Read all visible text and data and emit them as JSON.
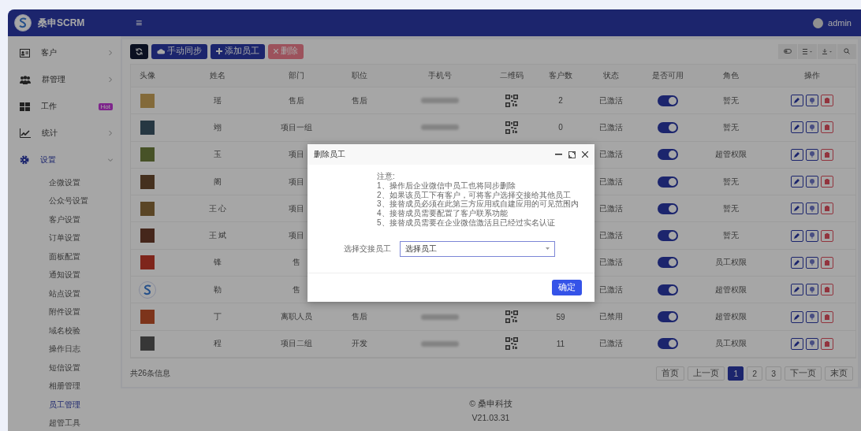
{
  "header": {
    "brand": "桑申SCRM",
    "menu_glyph": "≡",
    "user": "admin"
  },
  "sidebar": {
    "items": [
      {
        "label": "客户",
        "kind": "card",
        "expanded": false,
        "has_children": true
      },
      {
        "label": "群管理",
        "kind": "people",
        "expanded": false,
        "has_children": true
      },
      {
        "label": "工作",
        "kind": "grid",
        "expanded": false,
        "has_children": false,
        "badge": "Hot"
      },
      {
        "label": "统计",
        "kind": "chart",
        "expanded": false,
        "has_children": true
      },
      {
        "label": "设置",
        "kind": "gear",
        "expanded": true,
        "has_children": true,
        "children": [
          {
            "label": "企微设置",
            "selected": false
          },
          {
            "label": "公众号设置",
            "selected": false
          },
          {
            "label": "客户设置",
            "selected": false
          },
          {
            "label": "订单设置",
            "selected": false
          },
          {
            "label": "面板配置",
            "selected": false
          },
          {
            "label": "通知设置",
            "selected": false
          },
          {
            "label": "站点设置",
            "selected": false
          },
          {
            "label": "附件设置",
            "selected": false
          },
          {
            "label": "域名校验",
            "selected": false
          },
          {
            "label": "操作日志",
            "selected": false
          },
          {
            "label": "短信设置",
            "selected": false
          },
          {
            "label": "相册管理",
            "selected": false
          },
          {
            "label": "员工管理",
            "selected": true
          },
          {
            "label": "超管工具",
            "selected": false
          }
        ]
      }
    ]
  },
  "toolbar": {
    "buttons": [
      {
        "kind": "refresh",
        "disabled": false
      },
      {
        "kind": "sync",
        "label": "手动同步",
        "disabled": false
      },
      {
        "kind": "add",
        "label": "添加员工",
        "disabled": false
      },
      {
        "kind": "delete",
        "label": "删除",
        "disabled": true
      }
    ]
  },
  "table": {
    "columns": [
      "头像",
      "姓名",
      "部门",
      "职位",
      "手机号",
      "二维码",
      "客户数",
      "状态",
      "是否可用",
      "角色",
      "操作"
    ],
    "rows": [
      {
        "avatar": {
          "kind": "photo"
        },
        "name": "瑶",
        "department": "售后",
        "position": "售后",
        "phone_redacted": true,
        "qr": true,
        "customers": "2",
        "status": "已激活",
        "enabled": true,
        "role": "暂无"
      },
      {
        "avatar": {
          "kind": "photo"
        },
        "name": "翊",
        "department": "项目一组",
        "phone_redacted": true,
        "qr": true,
        "customers": "0",
        "status": "已激活",
        "enabled": true,
        "role": "暂无"
      },
      {
        "avatar": {
          "kind": "photo"
        },
        "name": "玉",
        "department": "项目",
        "status": "已激活",
        "enabled": true,
        "role": "超管权限"
      },
      {
        "avatar": {
          "kind": "photo"
        },
        "name": "阁",
        "department": "项目",
        "status": "已激活",
        "enabled": true,
        "role": "暂无"
      },
      {
        "avatar": {
          "kind": "photo"
        },
        "name": "王 心",
        "department": "项目",
        "status": "已激活",
        "enabled": true,
        "role": "暂无"
      },
      {
        "avatar": {
          "kind": "photo"
        },
        "name": "王 斌",
        "department": "项目",
        "status": "已激活",
        "enabled": true,
        "role": "暂无"
      },
      {
        "avatar": {
          "kind": "photo"
        },
        "name": "锋",
        "department": "售",
        "status": "已激活",
        "enabled": true,
        "role": "员工权限"
      },
      {
        "avatar": {
          "kind": "logo"
        },
        "name": "勒",
        "department": "售",
        "status": "已激活",
        "enabled": true,
        "role": "超管权限"
      },
      {
        "avatar": {
          "kind": "photo"
        },
        "name": "丁",
        "department": "离职人员",
        "position": "售后",
        "phone_redacted": true,
        "qr": true,
        "customers": "59",
        "status": "已禁用",
        "enabled": true,
        "role": "超管权限"
      },
      {
        "avatar": {
          "kind": "photo"
        },
        "name": "程",
        "department": "项目二组",
        "position": "开发",
        "phone_redacted": true,
        "qr": true,
        "customers": "11",
        "status": "已激活",
        "enabled": true,
        "role": "员工权限"
      }
    ]
  },
  "summary": "共26条信息",
  "pagination": [
    {
      "label": "首页",
      "selected": false
    },
    {
      "label": "上一页",
      "selected": false
    },
    {
      "label": "1",
      "selected": true
    },
    {
      "label": "2",
      "selected": false
    },
    {
      "label": "3",
      "selected": false
    },
    {
      "label": "下一页",
      "selected": false
    },
    {
      "label": "末页",
      "selected": false
    }
  ],
  "footer": {
    "company": "© 桑申科技",
    "version": "V21.03.31"
  },
  "dialog": {
    "title": "删除员工",
    "notes": [
      "注意:",
      "1、操作后企业微信中员工也将同步删除",
      "2、如果该员工下有客户，可将客户选择交接给其他员工",
      "3、接替成员必须在此第三方应用或自建应用的可见范围内",
      "4、接替成员需要配置了客户联系功能",
      "5、接替成员需要在企业微信激活且已经过实名认证"
    ],
    "field_label": "选择交接员工",
    "select_value": "选择员工",
    "confirm": "确定"
  }
}
